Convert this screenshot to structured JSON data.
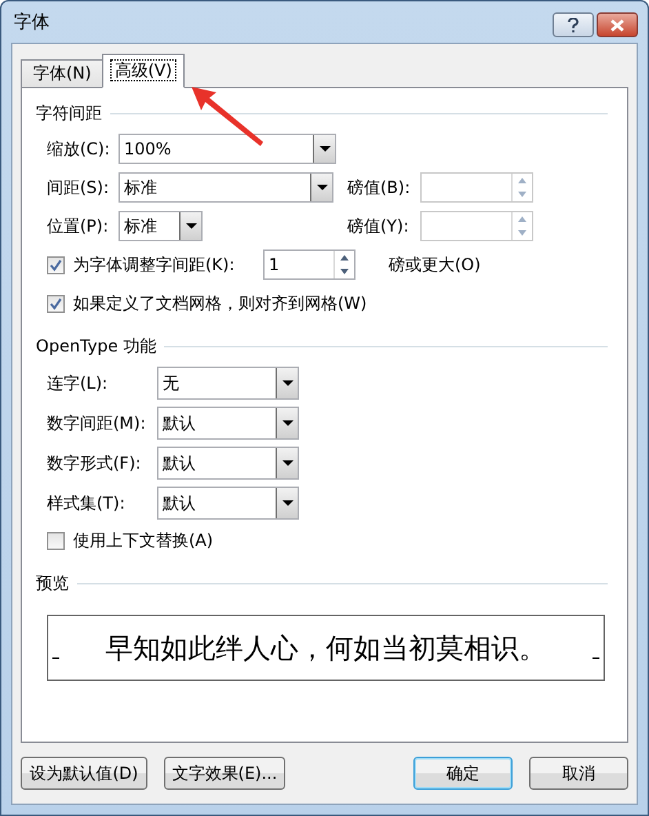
{
  "window": {
    "title": "字体"
  },
  "tabs": [
    {
      "label": "字体(N)",
      "selected": false
    },
    {
      "label": "高级(V)",
      "selected": true
    }
  ],
  "character_spacing": {
    "title": "字符间距",
    "rows": [
      {
        "label": "缩放(C):",
        "value": "100%"
      },
      {
        "label": "间距(S):",
        "value": "标准",
        "points": {
          "label": "磅值(B):",
          "disabled": true
        }
      },
      {
        "label": "位置(P):",
        "value": "标准",
        "points": {
          "label": "磅值(Y):",
          "disabled": true
        }
      }
    ],
    "kerning": {
      "checked": true,
      "label": "为字体调整字间距(K):",
      "value": "1",
      "suffix": "磅或更大(O)"
    },
    "snap_to_grid": {
      "checked": true,
      "label": "如果定义了文档网格，则对齐到网格(W)"
    }
  },
  "opentype": {
    "title": "OpenType 功能",
    "rows": [
      {
        "label": "连字(L):",
        "value": "无"
      },
      {
        "label": "数字间距(M):",
        "value": "默认"
      },
      {
        "label": "数字形式(F):",
        "value": "默认"
      },
      {
        "label": "样式集(T):",
        "value": "默认"
      }
    ],
    "contextual": {
      "checked": false,
      "label": "使用上下文替换(A)"
    }
  },
  "preview": {
    "title": "预览",
    "text": "早知如此绊人心，何如当初莫相识。"
  },
  "buttons": [
    {
      "label": "设为默认值(D)",
      "default": false
    },
    {
      "label": "文字效果(E)...",
      "default": false
    },
    {
      "label": "确定",
      "default": true
    },
    {
      "label": "取消",
      "default": false
    }
  ]
}
